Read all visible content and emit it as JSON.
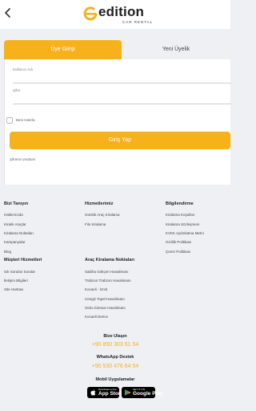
{
  "header": {
    "logo_text": "edition",
    "logo_sub": "CAR RENTAL",
    "accent": "#f7b11a",
    "back_icon": "arrow-left-icon"
  },
  "auth": {
    "tab_login": "Üye Girişi",
    "tab_register": "Yeni Üyelik",
    "username_label": "Kullanıcı Adı",
    "username_value": "",
    "password_label": "Şifre",
    "password_value": "",
    "remember_label": "Beni Hatırla",
    "remember_checked": false,
    "login_button": "Giriş Yap",
    "forgot_link": "Şifremi Unuttum"
  },
  "footer": {
    "col1": {
      "title": "Bizi Tanıyın",
      "links": [
        "Hakkımızda",
        "Kiralık Araçlar",
        "Kiralama Noktaları",
        "Kampanyalar",
        "Blog"
      ]
    },
    "col2": {
      "title": "Hizmetlerimiz",
      "links": [
        "Günlük Araç Kiralama",
        "Filo Kiralama"
      ]
    },
    "col3": {
      "title": "Bilgilendirme",
      "links": [
        "Kiralama Koşulları",
        "Kiralama Sözleşmesi",
        "KVKK Aydınlatma Metni",
        "Gizlilik Politikası",
        "Çerez Politikası"
      ]
    },
    "col4": {
      "title": "Müşteri Hizmetleri",
      "links": [
        "Sık Sorulan Sorular",
        "İletişim Bilgileri",
        "Site Haritası"
      ]
    },
    "col5": {
      "title": "Araç Kiralama Noktaları",
      "links": [
        "Sabiha Gökçen Havalimanı",
        "Trabzon Trabzon Havalimanı",
        "Kocaeli - İzmit",
        "Cengiz Topel Havalimanı",
        "Ordu Giresun Havalimanı",
        "Kocaeli Derice"
      ]
    },
    "contact_title": "Bize Ulaşın",
    "contact_phone": "+90 850 303 61 54",
    "whatsapp_title": "WhatsApp Destek",
    "whatsapp_phone": "+90 530 476 64 54",
    "apps_title": "Mobil Uygulamalar",
    "appstore_small": "Download on the",
    "appstore_big": "App Store",
    "googleplay_small": "GET IT ON",
    "googleplay_big": "Google Play"
  }
}
